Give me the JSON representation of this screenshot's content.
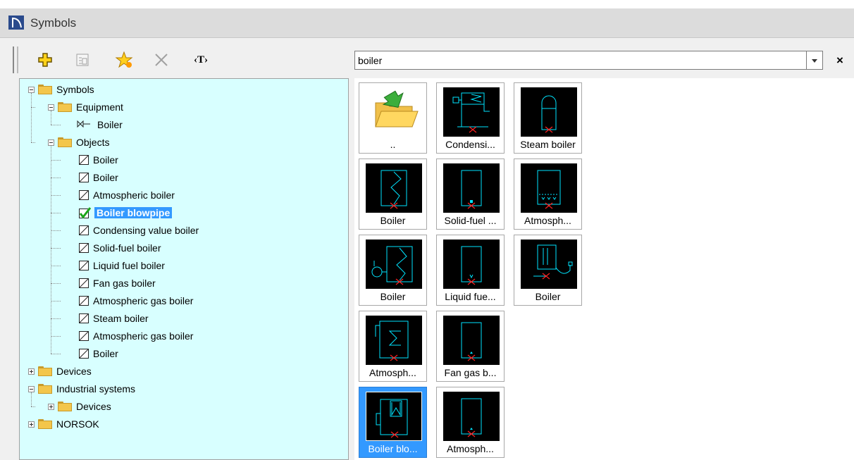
{
  "window": {
    "title": "Symbols"
  },
  "toolbar": {
    "search_value": "boiler",
    "text_tool_label": "‹T›",
    "icons": [
      "add-icon",
      "properties-icon",
      "favorite-star-icon",
      "delete-icon",
      "text-icon"
    ]
  },
  "tree": [
    {
      "label": "Symbols",
      "type": "folder",
      "expanded": true
    },
    {
      "label": "Equipment",
      "type": "folder",
      "expanded": true
    },
    {
      "label": "Boiler",
      "type": "equipment"
    },
    {
      "label": "Objects",
      "type": "folder",
      "expanded": true
    },
    {
      "label": "Boiler",
      "type": "object"
    },
    {
      "label": "Boiler",
      "type": "object"
    },
    {
      "label": "Atmospheric boiler",
      "type": "object"
    },
    {
      "label": "Boiler blowpipe",
      "type": "object",
      "selected": true
    },
    {
      "label": "Condensing value boiler",
      "type": "object"
    },
    {
      "label": "Solid-fuel boiler",
      "type": "object"
    },
    {
      "label": "Liquid fuel boiler",
      "type": "object"
    },
    {
      "label": "Fan gas boiler",
      "type": "object"
    },
    {
      "label": "Atmospheric gas boiler",
      "type": "object"
    },
    {
      "label": "Steam boiler",
      "type": "object"
    },
    {
      "label": "Atmospheric gas boiler",
      "type": "object"
    },
    {
      "label": "Boiler",
      "type": "object"
    },
    {
      "label": "Devices",
      "type": "folder",
      "expanded": false
    },
    {
      "label": "Industrial systems",
      "type": "folder",
      "expanded": true
    },
    {
      "label": "Devices",
      "type": "folder",
      "expanded": false
    },
    {
      "label": "NORSOK",
      "type": "folder",
      "expanded": false
    }
  ],
  "tiles": [
    {
      "label": "..",
      "kind": "folder-up"
    },
    {
      "label": "Condensi...",
      "kind": "condensing"
    },
    {
      "label": "Steam boiler",
      "kind": "steam"
    },
    {
      "label": "Boiler",
      "kind": "zigzag"
    },
    {
      "label": "Solid-fuel ...",
      "kind": "solid"
    },
    {
      "label": "Atmosph...",
      "kind": "atmos"
    },
    {
      "label": "Boiler",
      "kind": "boiler-fan"
    },
    {
      "label": "Liquid fue...",
      "kind": "liquid"
    },
    {
      "label": "Boiler",
      "kind": "boiler-pipe"
    },
    {
      "label": "Atmosph...",
      "kind": "atmos-sigma"
    },
    {
      "label": "Fan gas b...",
      "kind": "fangas"
    },
    {
      "label": "Boiler blo...",
      "kind": "blowpipe",
      "selected": true
    },
    {
      "label": "Atmosph...",
      "kind": "atmos2"
    }
  ],
  "colors": {
    "tree_bg": "#d8ffff",
    "selection": "#3399ff",
    "symbol_stroke": "#00e5ff",
    "symbol_marker": "#ff2020"
  }
}
